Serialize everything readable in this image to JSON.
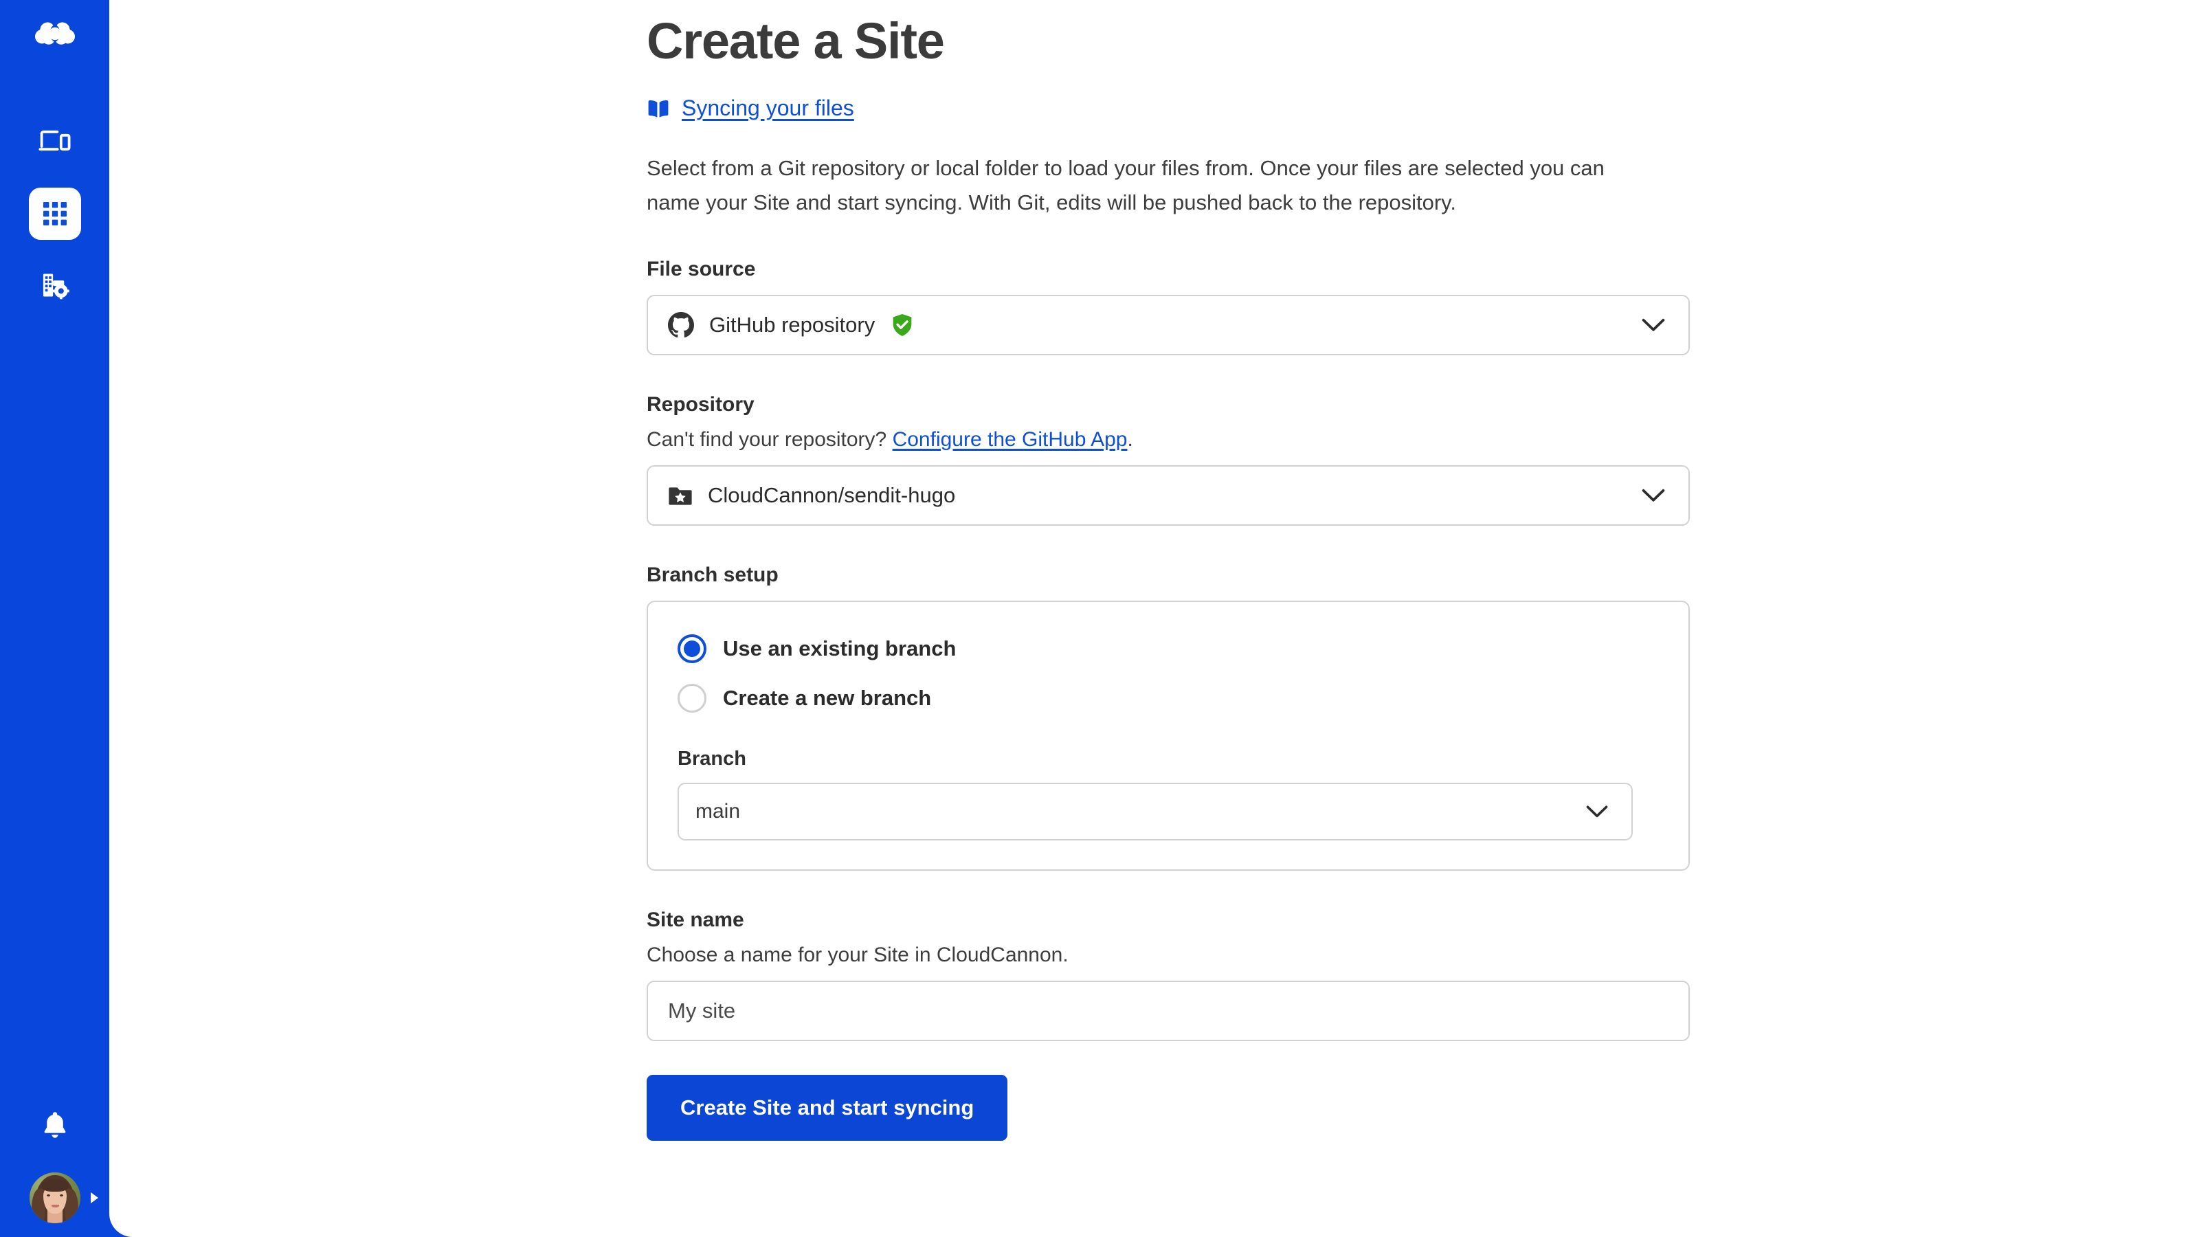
{
  "brand": {
    "logo_name": "cloudcannon-logo",
    "sidebar_color": "#0846dc",
    "accent_color": "#0d4fd8",
    "button_color": "#0b46d4",
    "verified_color": "#3aa81a"
  },
  "sidebar": {
    "items": [
      {
        "icon": "devices-icon",
        "label": "Sites",
        "active": false
      },
      {
        "icon": "grid-apps-icon",
        "label": "Apps",
        "active": true
      },
      {
        "icon": "organization-settings-icon",
        "label": "Organization settings",
        "active": false
      }
    ],
    "bottom": {
      "notifications_icon": "bell-icon",
      "avatar_name": "user-avatar",
      "expand_icon": "caret-right-icon"
    }
  },
  "page": {
    "title": "Create a Site",
    "doc_link": {
      "icon": "book-icon",
      "label": "Syncing your files"
    },
    "intro": "Select from a Git repository or local folder to load your files from. Once your files are selected you can name your Site and start syncing. With Git, edits will be pushed back to the repository."
  },
  "file_source": {
    "label": "File source",
    "icon": "github-icon",
    "value": "GitHub repository",
    "verified_icon": "verified-shield-icon",
    "chevron_icon": "chevron-down-icon"
  },
  "repository": {
    "label": "Repository",
    "help_prefix": "Can't find your repository? ",
    "help_link": "Configure the GitHub App",
    "help_suffix": ".",
    "icon": "repo-folder-star-icon",
    "value": "CloudCannon/sendit-hugo",
    "chevron_icon": "chevron-down-icon"
  },
  "branch_setup": {
    "label": "Branch setup",
    "options": [
      {
        "label": "Use an existing branch",
        "selected": true
      },
      {
        "label": "Create a new branch",
        "selected": false
      }
    ],
    "branch_label": "Branch",
    "branch_value": "main",
    "chevron_icon": "chevron-down-icon"
  },
  "site_name": {
    "label": "Site name",
    "help": "Choose a name for your Site in CloudCannon.",
    "value": "My site",
    "placeholder": "My site"
  },
  "submit": {
    "label": "Create Site and start syncing"
  }
}
